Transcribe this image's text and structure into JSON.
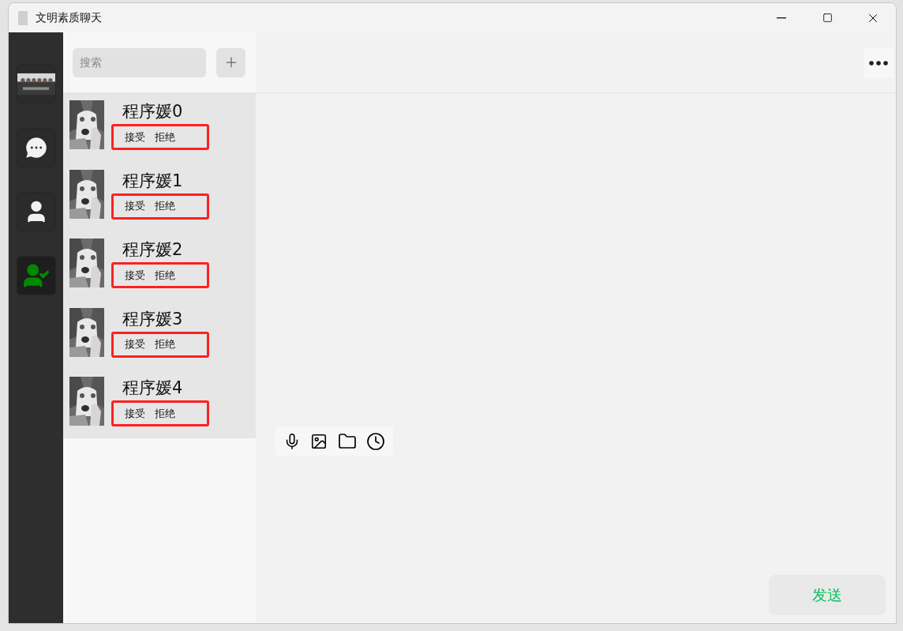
{
  "window": {
    "title": "文明素质聊天"
  },
  "sidebar": {
    "items": [
      {
        "kind": "avatar",
        "selected": false
      },
      {
        "kind": "chat",
        "selected": false
      },
      {
        "kind": "contacts",
        "selected": false
      },
      {
        "kind": "requests",
        "selected": true
      }
    ]
  },
  "search": {
    "placeholder": "搜索"
  },
  "requests": [
    {
      "name": "程序媛0",
      "accept": "接受",
      "reject": "拒绝"
    },
    {
      "name": "程序媛1",
      "accept": "接受",
      "reject": "拒绝"
    },
    {
      "name": "程序媛2",
      "accept": "接受",
      "reject": "拒绝"
    },
    {
      "name": "程序媛3",
      "accept": "接受",
      "reject": "拒绝"
    },
    {
      "name": "程序媛4",
      "accept": "接受",
      "reject": "拒绝"
    }
  ],
  "send_button": "发送"
}
